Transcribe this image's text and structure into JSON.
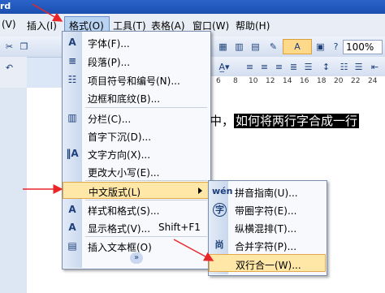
{
  "window": {
    "title_fragment": "rd"
  },
  "menubar": [
    {
      "label": "(V)"
    },
    {
      "label": "插入(I)"
    },
    {
      "label": "格式(O)"
    },
    {
      "label": "工具(T)"
    },
    {
      "label": "表格(A)"
    },
    {
      "label": "窗口(W)"
    },
    {
      "label": "帮助(H)"
    }
  ],
  "toolbar": {
    "zoom": "100%",
    "style_glyph": "A",
    "ruler_numbers": [
      "6",
      "8",
      "10",
      "12",
      "14",
      "16",
      "18",
      "20",
      "22",
      "24"
    ]
  },
  "document": {
    "text_plain": "中，",
    "text_selected": "如何将两行字合成一行"
  },
  "format_menu": {
    "items": [
      {
        "label": "字体(F)...",
        "icon": "font-A-icon",
        "glyph": "A"
      },
      {
        "label": "段落(P)...",
        "icon": "paragraph-icon",
        "glyph": "≡"
      },
      {
        "label": "项目符号和编号(N)...",
        "icon": "bullets-icon",
        "glyph": "☷"
      },
      {
        "label": "边框和底纹(B)...",
        "icon": "borders-icon",
        "glyph": ""
      },
      {
        "label": "分栏(C)...",
        "icon": "columns-icon",
        "glyph": "▥"
      },
      {
        "label": "首字下沉(D)...",
        "icon": "dropcap-icon",
        "glyph": ""
      },
      {
        "label": "文字方向(X)...",
        "icon": "text-direction-icon",
        "glyph": "‖A"
      },
      {
        "label": "更改大小写(E)...",
        "icon": "change-case-icon",
        "glyph": ""
      },
      {
        "label": "中文版式(L)",
        "icon": "chinese-layout-icon",
        "glyph": ""
      },
      {
        "label": "样式和格式(S)...",
        "icon": "styles-icon",
        "glyph": "A"
      },
      {
        "label": "显示格式(V)...",
        "icon": "reveal-format-icon",
        "glyph": "A"
      },
      {
        "label": "插入文本框(O)",
        "icon": "textbox-icon",
        "glyph": "▤"
      }
    ],
    "shortcut_reveal": "Shift+F1",
    "more_glyph": "»"
  },
  "submenu": {
    "items": [
      {
        "label": "拼音指南(U)...",
        "icon": "phonetic-guide-icon",
        "glyph": "wén"
      },
      {
        "label": "带圈字符(E)...",
        "icon": "enclosed-char-icon",
        "glyph": "字"
      },
      {
        "label": "纵横混排(T)...",
        "icon": "horizontal-in-vertical-icon",
        "glyph": ""
      },
      {
        "label": "合并字符(P)...",
        "icon": "combine-chars-icon",
        "glyph": "尚"
      },
      {
        "label": "双行合一(W)...",
        "icon": "two-lines-in-one-icon",
        "glyph": ""
      }
    ]
  },
  "colors": {
    "highlight": "#ffe7a8",
    "highlight_border": "#e3a84a",
    "arrow": "#e8262a",
    "menu_bg": "#f7f9fc"
  }
}
